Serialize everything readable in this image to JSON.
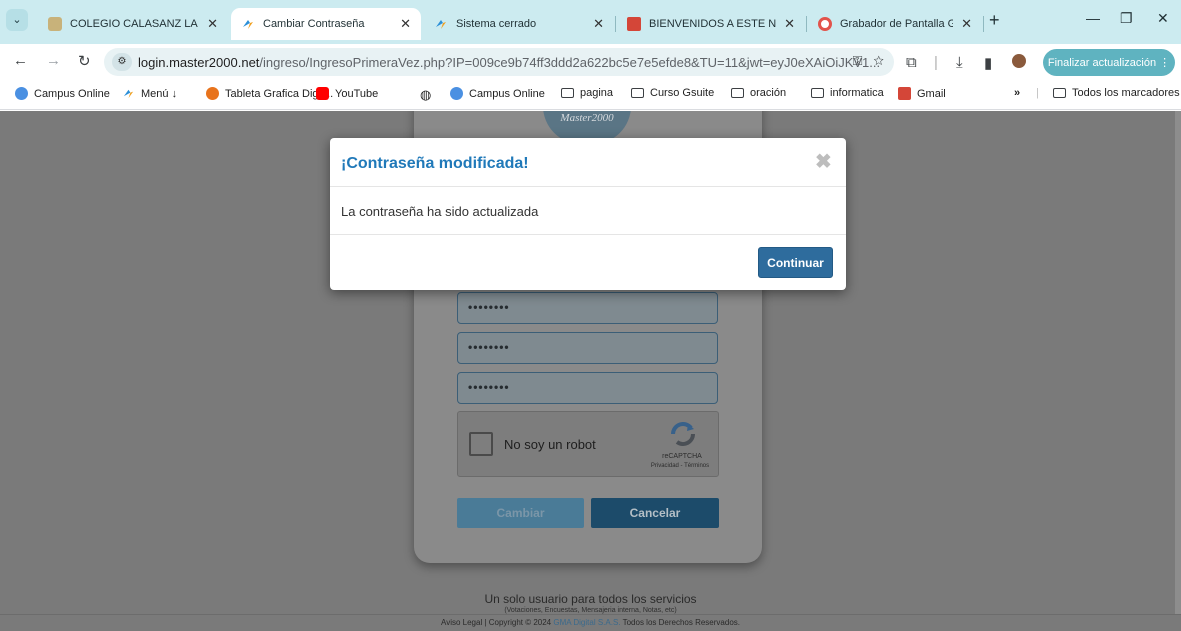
{
  "browser": {
    "tabs": [
      {
        "label": "COLEGIO CALASANZ LA ESM",
        "active": false
      },
      {
        "label": "Cambiar Contraseña",
        "active": true
      },
      {
        "label": "Sistema cerrado",
        "active": false
      },
      {
        "label": "BIENVENIDOS A ESTE NUEV",
        "active": false
      },
      {
        "label": "Grabador de Pantalla Gratis",
        "active": false
      }
    ],
    "address": {
      "host": "login.master2000.net",
      "path": "/ingreso/IngresoPrimeraVez.php?IP=009ce9b74ff3ddd2a622bc5e7e5efde8&TU=11&jwt=eyJ0eXAiOiJKV1..."
    },
    "update_button": "Finalizar actualización",
    "bookmarks": [
      {
        "label": "Campus Online"
      },
      {
        "label": "Menú ↓"
      },
      {
        "label": "Tableta Grafica Digit..."
      },
      {
        "label": "YouTube"
      },
      {
        "label": "Campus Online"
      },
      {
        "label": "pagina"
      },
      {
        "label": "Curso Gsuite"
      },
      {
        "label": "oración"
      },
      {
        "label": "informatica"
      },
      {
        "label": "Gmail"
      },
      {
        "label": "Todos los marcadores"
      }
    ],
    "colors": {
      "tabbar": "#ccebf0",
      "update_button": "#5fb3c0"
    }
  },
  "page": {
    "logo_text": "Master2000",
    "password_fields": [
      "••••••••",
      "••••••••",
      "••••••••"
    ],
    "captcha": {
      "label": "No soy un robot",
      "brand": "reCAPTCHA",
      "links": "Privacidad - Términos"
    },
    "buttons": {
      "change": "Cambiar",
      "cancel": "Cancelar"
    },
    "footer": {
      "tagline": "Un solo usuario para todos los servicios",
      "services": "(Votaciones, Encuestas, Mensajeria interna, Notas, etc)",
      "legal_prefix": "Aviso Legal | Copyright © 2024",
      "company": "GMA Digital S.A.S.",
      "legal_suffix": "Todos los Derechos Reservados."
    }
  },
  "modal": {
    "title": "¡Contraseña modificada!",
    "message": "La contraseña ha sido actualizada",
    "close_symbol": "✖",
    "continue_button": "Continuar",
    "colors": {
      "title": "#2079b9",
      "button": "#2e6c9d"
    }
  }
}
